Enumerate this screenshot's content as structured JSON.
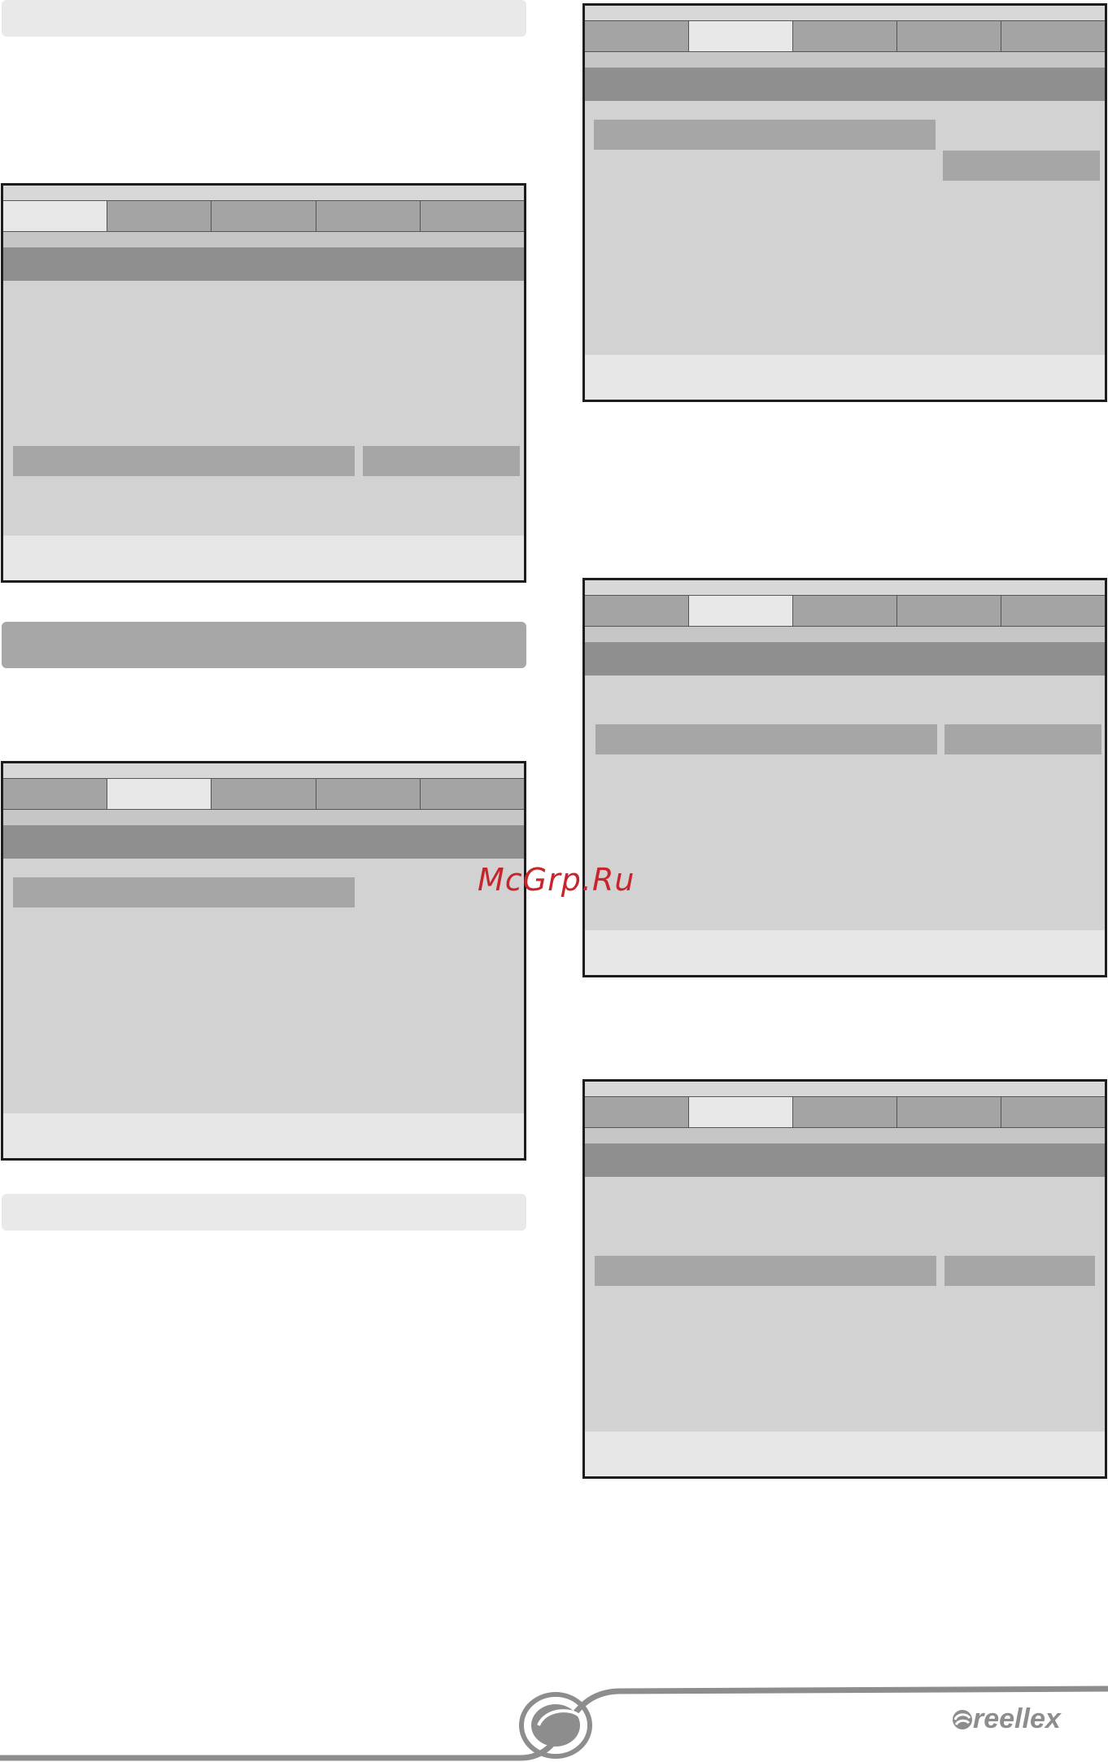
{
  "watermark": "McGrp.Ru",
  "brand": {
    "name": "reellex",
    "color": "#8d8d8d"
  },
  "colors": {
    "tab_active": "#e8e8e8",
    "tab_inactive": "#a4a4a4",
    "screen_bg": "#d2d2d2",
    "header": "#8f8f8f",
    "watermark": "#c8242b"
  },
  "screens": [
    {
      "id": "screen-1",
      "active_tab": 1,
      "tabs": 5
    },
    {
      "id": "screen-2",
      "active_tab": 2,
      "tabs": 5
    },
    {
      "id": "screen-3",
      "active_tab": 2,
      "tabs": 5
    },
    {
      "id": "screen-4",
      "active_tab": 2,
      "tabs": 5
    },
    {
      "id": "screen-5",
      "active_tab": 2,
      "tabs": 5
    }
  ]
}
